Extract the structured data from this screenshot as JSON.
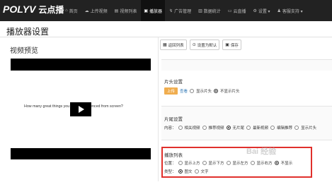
{
  "app": {
    "logo_brand": "POLYV",
    "logo_cn": "云点播"
  },
  "nav": {
    "items": [
      {
        "label": "首页",
        "icon": "⌂"
      },
      {
        "label": "上传视频",
        "icon": "☁"
      },
      {
        "label": "视频列表",
        "icon": "▤"
      },
      {
        "label": "播放器",
        "icon": "▣"
      },
      {
        "label": "广告管理",
        "icon": "↯"
      },
      {
        "label": "数据统计",
        "icon": "▥"
      },
      {
        "label": "云直播",
        "icon": "▭"
      },
      {
        "label": "设置 ▾",
        "icon": "⚙"
      },
      {
        "label": "客服支持 ▾",
        "icon": "♟"
      }
    ],
    "active_index": 3
  },
  "page": {
    "title": "播放器设置"
  },
  "preview": {
    "title": "视频预览",
    "caption": "How many great things you have experienced from screen?"
  },
  "toolbar": {
    "return_list": "返回列表",
    "set_default": "设置为默认",
    "save": "保存"
  },
  "header_section": {
    "title": "片头设置",
    "on_label": "上传",
    "view_label": "查看",
    "opt_show": "显示片头",
    "opt_hide": "不显示片头"
  },
  "tail_section": {
    "title": "片尾设置",
    "content_label": "内容：",
    "options": [
      "相关视频",
      "推荐视频",
      "无片尾",
      "最新视频",
      "编辑推荐",
      "显示片头"
    ]
  },
  "playlist_section": {
    "title": "播放列表",
    "position_label": "位置：",
    "positions": [
      "显示上方",
      "显示下方",
      "显示左方",
      "显示右方",
      "不显示"
    ],
    "type_label": "类型：",
    "types": [
      "图文",
      "文字"
    ]
  },
  "watermark": "Bai 经验",
  "colors": {
    "topbar": "#222222",
    "accent": "#f0ad4e",
    "highlight": "#e0302c",
    "link": "#337ab7"
  }
}
